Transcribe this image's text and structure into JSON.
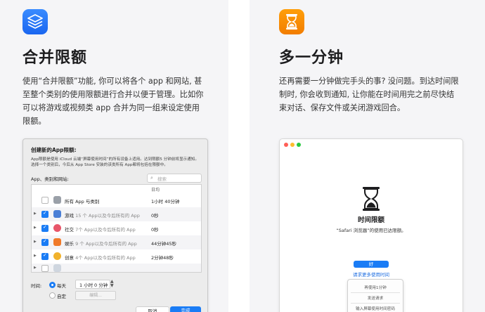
{
  "left": {
    "icon": "stacked-layers-icon",
    "title": "合并限额",
    "desc": "使用“合并限额”功能, 你可以将各个 app 和网站, 甚至整个类别的使用限额进行合并以便于管理。比如你可以将游戏或视频类 app 合并为同一组来设定使用限额。",
    "dialog": {
      "title": "创建新的App限额:",
      "desc": "App限额是使用 iCloud 云端“屏幕使用时间”的所有设备上适用。达到限额5 分钟前将显示通知。选择一个类别后，今后从 App Store 安装的该类所有 App都将包括在限额中。",
      "list_label": "App、类别和网站:",
      "search_placeholder": "搜索",
      "column_header": "日均",
      "rows": [
        {
          "name": "所有 App 与类别",
          "sub": "",
          "value": "1小时 40分钟",
          "checked": false,
          "icon_color": "#9aa0a8"
        },
        {
          "name": "游戏",
          "sub": " 15 个 App以及今后所有的 App",
          "value": "0秒",
          "checked": true,
          "icon_color": "#4a7fd6"
        },
        {
          "name": "社交",
          "sub": " 7个 App以及今后所有的 App",
          "value": "0秒",
          "checked": true,
          "icon_color": "#e8566a"
        },
        {
          "name": "娱乐",
          "sub": " 9 个 App以及今后所有的 App",
          "value": "44分钟45秒",
          "checked": true,
          "icon_color": "#f07a2a"
        },
        {
          "name": "创意",
          "sub": " 4个 App以及今后所有的 App",
          "value": "2分钟48秒",
          "checked": true,
          "icon_color": "#f1b22c"
        },
        {
          "name": "",
          "sub": "",
          "value": "",
          "checked": false,
          "icon_color": "#cfd6df"
        }
      ],
      "time_label": "时间:",
      "opt_everyday": "每天",
      "hours": "1 小时",
      "minutes": "0 分钟",
      "opt_custom": "自定",
      "edit_button": "编辑...",
      "cancel_button": "取消",
      "done_button": "完成"
    }
  },
  "right": {
    "icon": "hourglass-icon",
    "title": "多一分钟",
    "desc": "还再需要一分钟做完手头的事? 没问题。到达时间限制时, 你会收到通知, 让你能在时间用完之前尽快结束对话、保存文件或关闭游戏回合。",
    "window": {
      "heading": "时间限额",
      "message": "“Safari 浏览器”的使用已达限额。",
      "ok_button": "好",
      "more_link": "请求更多使用时间",
      "menu": [
        "再使用1分钟",
        "发送请求",
        "输入屏幕使用时间密码"
      ]
    }
  },
  "colors": {
    "accent_blue": "#1a7cf5",
    "orange": "#ff9f0a",
    "panel_bg": "#f5f5f7"
  }
}
